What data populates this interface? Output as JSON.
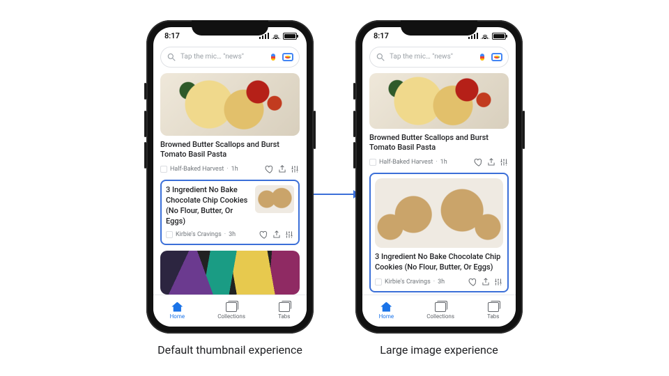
{
  "captions": {
    "left": "Default thumbnail experience",
    "right": "Large image experience"
  },
  "status": {
    "time": "8:17"
  },
  "search": {
    "placeholder": "Tap the mic… \"news\""
  },
  "articles": {
    "pasta": {
      "title": "Browned Butter Scallops and Burst Tomato Basil Pasta",
      "source": "Half-Baked Harvest",
      "age": "1h"
    },
    "cookies": {
      "title": "3 Ingredient No Bake Chocolate Chip Cookies (No Flour, Butter, Or Eggs)",
      "source": "Kirbie's Cravings",
      "age": "3h"
    }
  },
  "tabs": {
    "home": "Home",
    "collections": "Collections",
    "tabs": "Tabs"
  },
  "sep": "·"
}
